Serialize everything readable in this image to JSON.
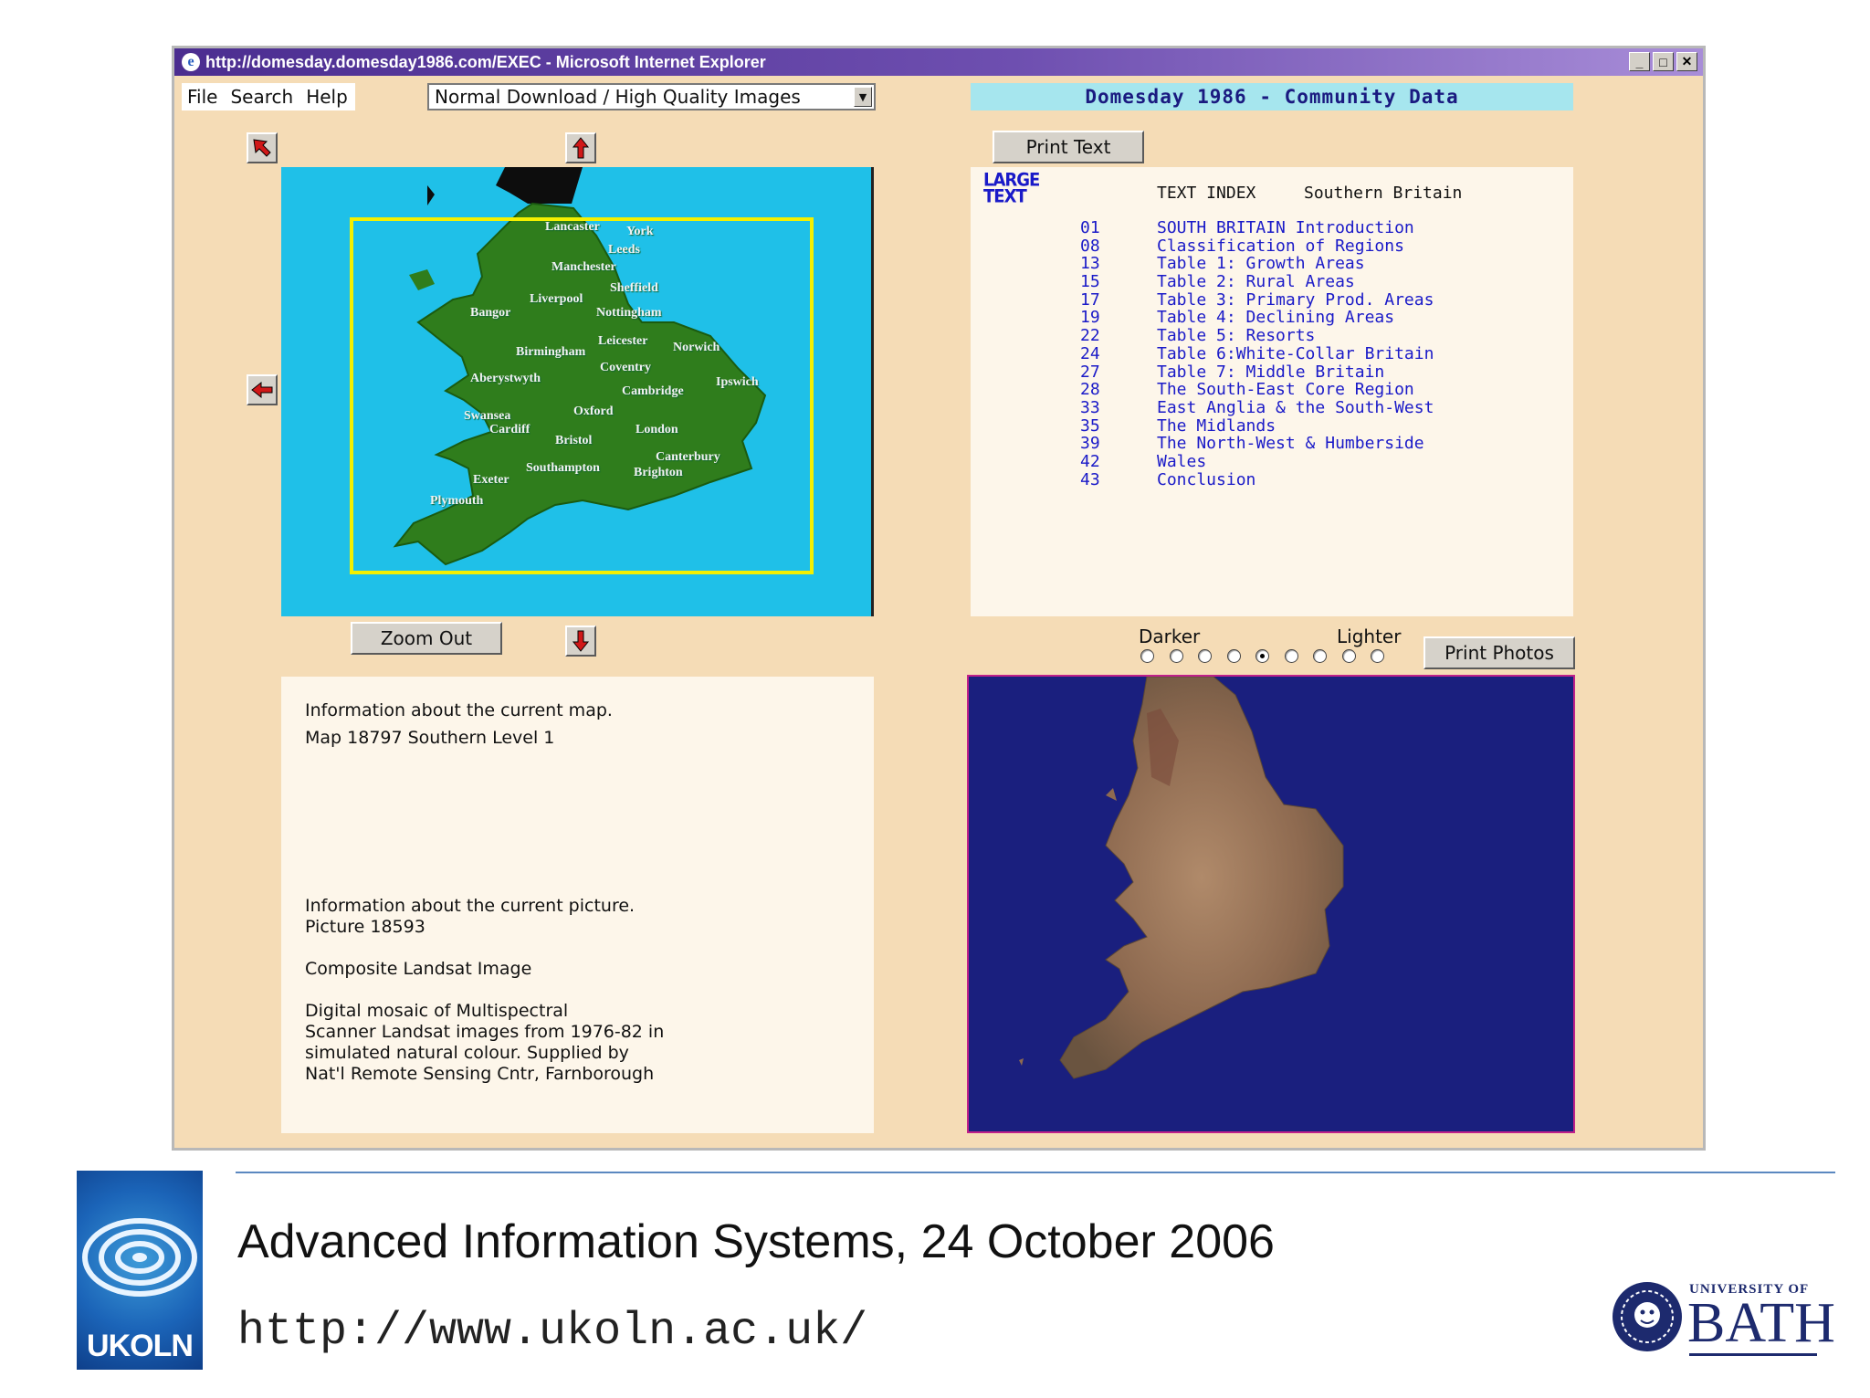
{
  "window": {
    "title": "http://domesday.domesday1986.com/EXEC - Microsoft Internet Explorer",
    "controls": {
      "minimize": "_",
      "maximize": "□",
      "close": "✕"
    }
  },
  "menu": {
    "file": "File",
    "search": "Search",
    "help": "Help"
  },
  "download_select": {
    "selected": "Normal Download / High Quality Images"
  },
  "app_title": "Domesday 1986 - Community Data",
  "buttons": {
    "print_text": "Print Text",
    "zoom_out": "Zoom Out",
    "print_photos": "Print Photos"
  },
  "map": {
    "cities": [
      "Lancaster",
      "York",
      "Leeds",
      "Manchester",
      "Sheffield",
      "Liverpool",
      "Bangor",
      "Nottingham",
      "Leicester",
      "Norwich",
      "Birmingham",
      "Coventry",
      "Aberystwyth",
      "Ipswich",
      "Cambridge",
      "Swansea",
      "Cardiff",
      "Oxford",
      "London",
      "Bristol",
      "Canterbury",
      "Southampton",
      "Brighton",
      "Exeter",
      "Plymouth"
    ]
  },
  "text_index": {
    "large_text_top": "LARGE",
    "large_text_bottom": "TEXT",
    "heading": "TEXT INDEX",
    "region": "Southern Britain",
    "entries": [
      {
        "num": "01",
        "title": "SOUTH BRITAIN Introduction"
      },
      {
        "num": "08",
        "title": "Classification of Regions"
      },
      {
        "num": "13",
        "title": "Table 1: Growth Areas"
      },
      {
        "num": "15",
        "title": "Table 2: Rural Areas"
      },
      {
        "num": "17",
        "title": "Table 3: Primary Prod. Areas"
      },
      {
        "num": "19",
        "title": "Table 4: Declining Areas"
      },
      {
        "num": "22",
        "title": "Table 5: Resorts"
      },
      {
        "num": "24",
        "title": "Table 6:White-Collar Britain"
      },
      {
        "num": "27",
        "title": "Table 7: Middle Britain"
      },
      {
        "num": "28",
        "title": "The South-East Core Region"
      },
      {
        "num": "33",
        "title": "East Anglia & the South-West"
      },
      {
        "num": "35",
        "title": "The Midlands"
      },
      {
        "num": "39",
        "title": "The North-West & Humberside"
      },
      {
        "num": "42",
        "title": "Wales"
      },
      {
        "num": "43",
        "title": "Conclusion"
      }
    ]
  },
  "map_info": {
    "heading": "Information about the current map.",
    "details": "Map  18797  Southern  Level 1"
  },
  "picture_info": {
    "heading": "Information about the current picture.",
    "picture_id": "Picture  18593",
    "title": "Composite Landsat Image",
    "desc_1": "Digital mosaic of Multispectral",
    "desc_2": "Scanner Landsat images from 1976-82 in",
    "desc_3": "simulated natural colour. Supplied by",
    "desc_4": "Nat'l Remote Sensing Cntr, Farnborough"
  },
  "brightness": {
    "darker": "Darker",
    "lighter": "Lighter",
    "levels": 9,
    "selected_index": 4
  },
  "footer": {
    "title": "Advanced Information Systems, 24 October 2006",
    "url": "http://www.ukoln.ac.uk/",
    "ukoln_logo": "UKOLN",
    "bath_small": "UNIVERSITY OF",
    "bath_big": "BATH"
  },
  "colors": {
    "window_bg": "#f5dcb6",
    "map_sea": "#1fc0e8",
    "map_land": "#2f7d1c",
    "highlight": "#f4f000",
    "index_link": "#1a1ac8",
    "photo_sea": "#1a1f7e"
  }
}
